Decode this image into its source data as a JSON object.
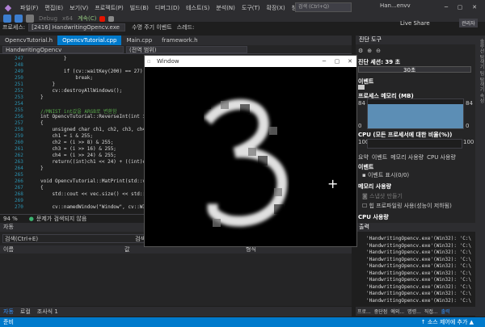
{
  "menu": {
    "items": [
      "파일(F)",
      "편집(E)",
      "보기(V)",
      "프로젝트(P)",
      "빌드(B)",
      "디버그(D)",
      "테스트(S)",
      "분석(N)",
      "도구(T)",
      "확장(X)",
      "창(W)",
      "도움말(H)"
    ]
  },
  "search": {
    "placeholder": "검색 (Ctrl+Q)"
  },
  "window_title": "Han...envv",
  "toolbar": {
    "config": "Debug",
    "platform": "x64",
    "continue": "계속(C)",
    "live_share": "Live Share",
    "admin": "관리자"
  },
  "process": {
    "label": "프로세스:",
    "value": "[2416] HandwritingOpencv.exe",
    "event": "수명 주기 이벤트",
    "thread": "스레드:"
  },
  "doc_tabs": [
    "OpencvTutorial.h",
    "OpencvTutorial.cpp",
    "Main.cpp",
    "framework.h"
  ],
  "nav": {
    "project": "HandwritingOpencv",
    "scope": "(전역 범위)"
  },
  "code": [
    {
      "ln": "247",
      "text": "        }"
    },
    {
      "ln": "248",
      "text": ""
    },
    {
      "ln": "249",
      "text": "        if (cv::waitKey(200) == 27)"
    },
    {
      "ln": "250",
      "text": "            break;"
    },
    {
      "ln": "251",
      "text": "    }"
    },
    {
      "ln": "252",
      "text": "    cv::destroyAllWindows();"
    },
    {
      "ln": "253",
      "text": "}"
    },
    {
      "ln": "254",
      "text": ""
    },
    {
      "ln": "255",
      "text": "//MNIST int값을 ARGB로 변환함"
    },
    {
      "ln": "256",
      "text": "int OpencvTutorial::ReverseInt(int i)"
    },
    {
      "ln": "257",
      "text": "{"
    },
    {
      "ln": "258",
      "text": "    unsigned char ch1, ch2, ch3, ch4;"
    },
    {
      "ln": "259",
      "text": "    ch1 = i & 255;"
    },
    {
      "ln": "260",
      "text": "    ch2 = (i >> 8) & 255;"
    },
    {
      "ln": "261",
      "text": "    ch3 = (i >> 16) & 255;"
    },
    {
      "ln": "262",
      "text": "    ch4 = (i >> 24) & 255;"
    },
    {
      "ln": "263",
      "text": "    return((int)ch1 << 24) + ((int)ch"
    },
    {
      "ln": "264",
      "text": "}"
    },
    {
      "ln": "265",
      "text": ""
    },
    {
      "ln": "266",
      "text": "void OpencvTutorial::MatPrint(std::ve"
    },
    {
      "ln": "267",
      "text": "{"
    },
    {
      "ln": "268",
      "text": "    std::cout << vec.size() << std::e"
    },
    {
      "ln": "269",
      "text": ""
    },
    {
      "ln": "270",
      "text": "    cv::namedWindow(\"Window\", cv::WIN"
    }
  ],
  "editor_status": {
    "zoom": "94 %",
    "issues": "문제가 검색되지 않음"
  },
  "bottom_panel": {
    "title": "자동",
    "search": "검색(Ctrl+E)",
    "col_name": "이름",
    "col_value": "값",
    "search_depth": "검색 심도:",
    "col_type": "형식"
  },
  "bottom_tabs": [
    "자동",
    "로컬",
    "조사식 1"
  ],
  "right_panel": {
    "title": "진단 도구",
    "session": "진단 세션: 39 초",
    "timeline_label": "30초",
    "events": "이벤트",
    "memory": "프로세스 메모리 (MB)",
    "mem_max": "84",
    "mem_min": "0",
    "mem_max_r": "84",
    "mem_min_r": "0",
    "cpu": "CPU (모든 프로세서에 대한 비율(%))",
    "cpu_max": "100",
    "cpu_max_r": "100",
    "tabs": [
      "요약",
      "이벤트",
      "메모리 사용량",
      "CPU 사용량"
    ],
    "events_head": "이벤트",
    "events_show": "이벤트 표시(0/0)",
    "memory_head": "메모리 사용량",
    "snapshot": "스냅샷 만들기",
    "heap_profile": "힙 프로파일링 사용(성능이 저하됨)",
    "cpu_head": "CPU 사용량"
  },
  "output": {
    "title": "출력",
    "lines": [
      "'HandwritingOpencv.exe'(Win32): 'C:\\",
      "'HandwritingOpencv.exe'(Win32): 'C:\\",
      "'HandwritingOpencv.exe'(Win32): 'C:\\",
      "'HandwritingOpencv.exe'(Win32): 'C:\\",
      "'HandwritingOpencv.exe'(Win32): 'C:\\",
      "'HandwritingOpencv.exe'(Win32): 'C:\\",
      "'HandwritingOpencv.exe'(Win32): 'C:\\",
      "'HandwritingOpencv.exe'(Win32): 'C:\\",
      "'HandwritingOpencv.exe'(Win32): 'C:\\",
      "'HandwritingOpencv.exe'(Win32): 'C:\\"
    ],
    "tabs": [
      "프로...",
      "중단점",
      "예외...",
      "명령...",
      "직접...",
      "출력"
    ]
  },
  "statusbar": {
    "ready": "준비",
    "source_control": "↑ 소스 제어에 추가 ▲"
  },
  "side_labels": "솔루션 탐색기  팀 탐색기  속성",
  "cv_window": {
    "title": "Window"
  },
  "colors": {
    "accent": "#007acc",
    "editor_bg": "#1e1e1e",
    "chrome": "#2d2d30"
  }
}
